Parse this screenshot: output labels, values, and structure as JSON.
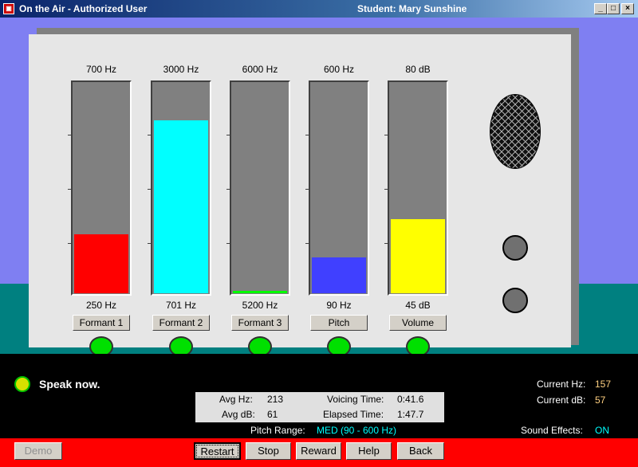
{
  "window": {
    "title": "On the Air - Authorized User",
    "student": "Student:  Mary Sunshine",
    "app_icon": "on-air-icon"
  },
  "meters": [
    {
      "id": "formant1",
      "top_label": "700 Hz",
      "bottom_label": "250 Hz",
      "button": "Formant 1",
      "fill_color": "#ff0000",
      "level": 0.28
    },
    {
      "id": "formant2",
      "top_label": "3000 Hz",
      "bottom_label": "701 Hz",
      "button": "Formant 2",
      "fill_color": "#00ffff",
      "level": 0.82
    },
    {
      "id": "formant3",
      "top_label": "6000 Hz",
      "bottom_label": "5200 Hz",
      "button": "Formant 3",
      "fill_color": "#00ff00",
      "level": 0.01
    },
    {
      "id": "pitch",
      "top_label": "600 Hz",
      "bottom_label": "90 Hz",
      "button": "Pitch",
      "fill_color": "#4040ff",
      "level": 0.17
    },
    {
      "id": "volume",
      "top_label": "80 dB",
      "bottom_label": "45 dB",
      "button": "Volume",
      "fill_color": "#ffff00",
      "level": 0.35
    }
  ],
  "status": {
    "message": "Speak now."
  },
  "stats": {
    "avg_hz_label": "Avg Hz:",
    "avg_hz": "213",
    "avg_db_label": "Avg dB:",
    "avg_db": "61",
    "voicing_label": "Voicing Time:",
    "voicing": "0:41.6",
    "elapsed_label": "Elapsed Time:",
    "elapsed": "1:47.7"
  },
  "pitch_range": {
    "label": "Pitch Range:",
    "value": "MED  (90 - 600 Hz)"
  },
  "current": {
    "hz_label": "Current Hz:",
    "hz": "157",
    "db_label": "Current dB:",
    "db": "57"
  },
  "sound_effects": {
    "label": "Sound  Effects:",
    "value": "ON"
  },
  "buttons": {
    "demo": "Demo",
    "restart": "Restart",
    "stop": "Stop",
    "reward": "Reward",
    "help": "Help",
    "back": "Back"
  }
}
